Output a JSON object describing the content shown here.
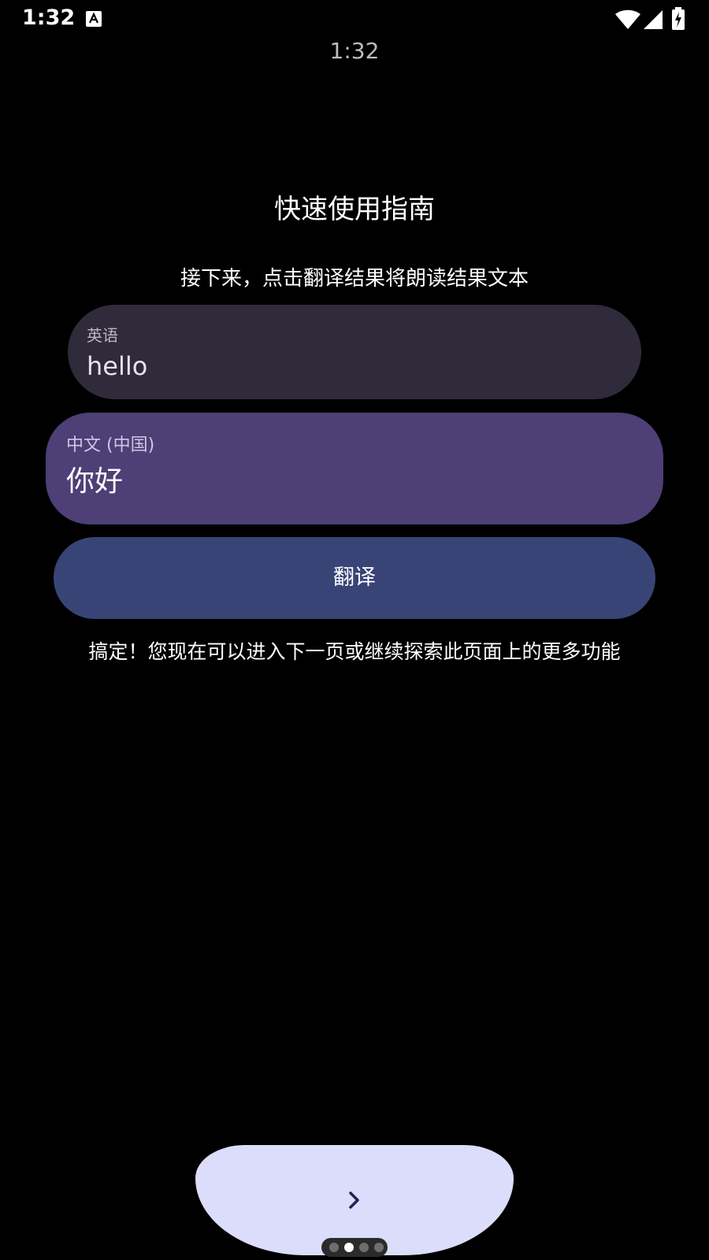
{
  "status_bar": {
    "time": "1:32",
    "icons": [
      "a-notification-icon",
      "wifi-icon",
      "cell-signal-icon",
      "battery-charging-icon"
    ]
  },
  "clock": "1:32",
  "guide": {
    "title": "快速使用指南",
    "subtitle": "接下来，点击翻译结果将朗读结果文本",
    "done_message": "搞定！您现在可以进入下一页或继续探索此页面上的更多功能"
  },
  "source": {
    "language": "英语",
    "text": "hello"
  },
  "result": {
    "language": "中文 (中国)",
    "text": "你好"
  },
  "translate_button": {
    "label": "翻译"
  },
  "pager": {
    "total": 4,
    "current": 2
  },
  "colors": {
    "background": "#000000",
    "source_card": "#2f2b3b",
    "result_card": "#4e3f76",
    "translate_button": "#394476",
    "next_button": "#dcdcfb",
    "chevron": "#2a1e52"
  }
}
